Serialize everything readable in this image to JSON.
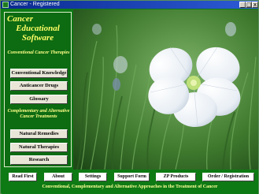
{
  "window": {
    "title": "Cancer - Registered",
    "controls": {
      "minimize": "_",
      "maximize": "□",
      "close": "x"
    }
  },
  "app": {
    "title_line1": "Cancer",
    "title_line2": "Educational Software"
  },
  "sections": {
    "conventional": "Conventional Cancer Therapies",
    "alternative": "Complementary and Alternative Cancer Treatments"
  },
  "nav": {
    "conventional_knowledge": "Conventional Knowledge",
    "anticancer_drugs": "Anticancer Drugs",
    "glossary": "Glossary",
    "natural_remedies": "Natural Remedies",
    "natural_therapies": "Natural Therapies",
    "research": "Research"
  },
  "bottom_buttons": {
    "read_first": "Read First",
    "about": "About",
    "settings": "Settings",
    "support_form": "Support Form",
    "zp_products": "ZP Products",
    "order_registration": "Order / Registration"
  },
  "tagline": "Conventional, Complementary and Alternative Approaches in the Treatment of Cancer",
  "colors": {
    "background_green": "#0e7a14",
    "panel_green": "#0d6b12",
    "title_yellow": "#ffff66",
    "titlebar_blue": "#0a2a8e"
  },
  "icons": {
    "app_icon": "app-icon",
    "photo": "blue-flax-flower-photo"
  }
}
